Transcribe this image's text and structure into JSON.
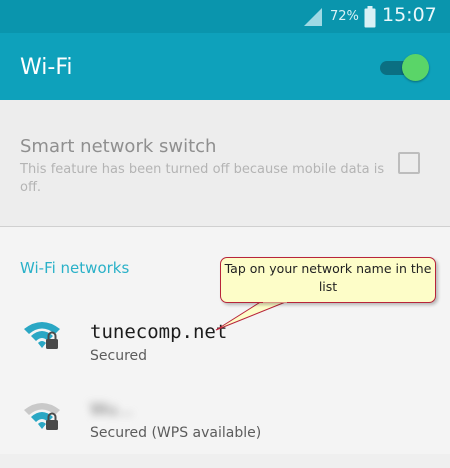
{
  "status_bar": {
    "battery_percent": "72%",
    "time": "15:07",
    "signal_icon": "cell-signal-icon",
    "battery_icon": "battery-icon"
  },
  "app_bar": {
    "title": "Wi-Fi",
    "toggle_on": true,
    "toggle_color": "#5ad568"
  },
  "smart_switch": {
    "title": "Smart network switch",
    "description": "This feature has been turned off because mobile data is off.",
    "checked": false
  },
  "networks": {
    "header": "Wi-Fi networks",
    "items": [
      {
        "name": "tunecomp.net",
        "status": "Secured",
        "icon": "wifi-locked-icon"
      },
      {
        "name": "Wu...",
        "status": "Secured (WPS available)",
        "icon": "wifi-locked-weak-icon"
      }
    ]
  },
  "callout": {
    "text": "Tap on your network name in the list"
  },
  "colors": {
    "accent": "#0ea1bb",
    "status_bar": "#0a95ad",
    "section_header": "#2ab1c8",
    "callout_border": "#b8243a"
  }
}
